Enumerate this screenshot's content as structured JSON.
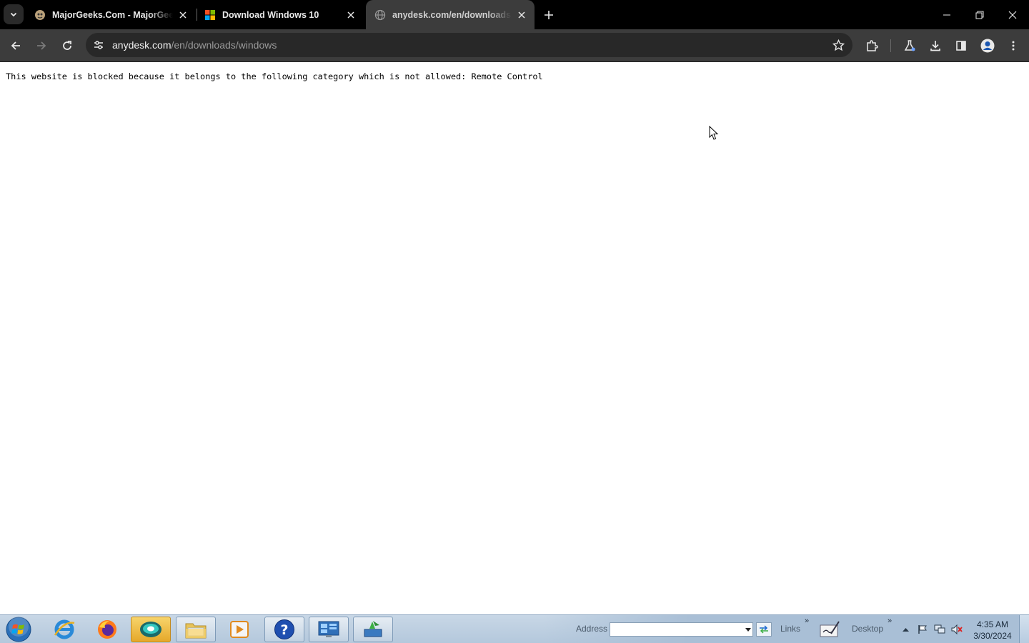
{
  "browser": {
    "tabs": [
      {
        "title": "MajorGeeks.Com - MajorGeeks",
        "icon": "majorgeeks-favicon",
        "active": false
      },
      {
        "title": "Download Windows 10",
        "icon": "microsoft-favicon",
        "active": false
      },
      {
        "title": "anydesk.com/en/downloads/windows",
        "icon": "globe-icon",
        "active": true
      }
    ],
    "url": {
      "host": "anydesk.com",
      "path": "/en/downloads/windows"
    }
  },
  "page": {
    "message": "This website is blocked because it belongs to the following category which is not allowed: Remote Control"
  },
  "taskbar": {
    "address_label": "Address",
    "address_value": "",
    "links_label": "Links",
    "desktop_label": "Desktop",
    "chevron": "»",
    "time": "4:35 AM",
    "date": "3/30/2024"
  },
  "colors": {
    "tabstrip": "#000000",
    "toolbar": "#3c3c3c",
    "omnibox": "#282828",
    "taskbar": "#c8d7e6"
  }
}
